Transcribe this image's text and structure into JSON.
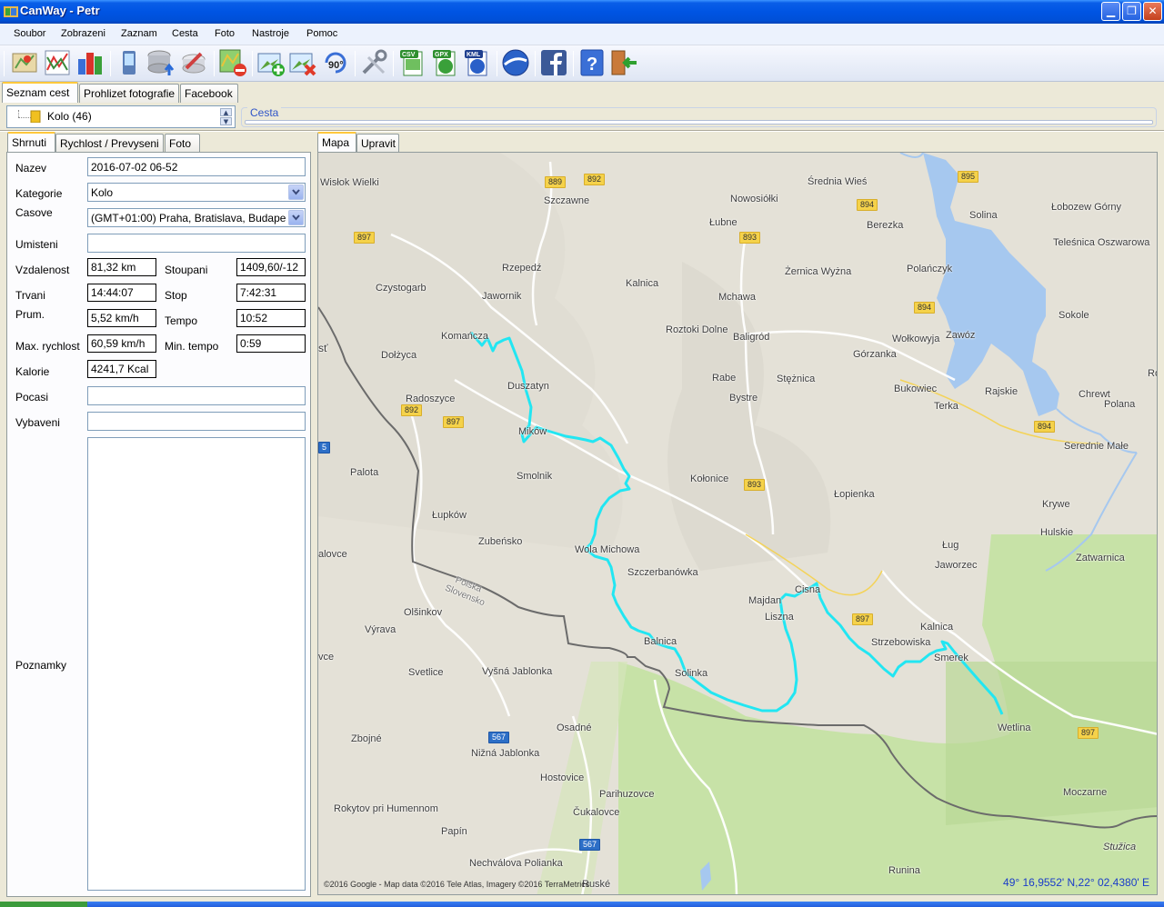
{
  "window": {
    "title": "CanWay - Petr",
    "minimize_icon": "minimize-icon",
    "maximize_icon": "maximize-icon",
    "close_icon": "close-icon"
  },
  "menu": [
    "Soubor",
    "Zobrazeni",
    "Zaznam",
    "Cesta",
    "Foto",
    "Nastroje",
    "Pomoc"
  ],
  "toolbar_icons": [
    "map-pin-icon",
    "chart-lines-icon",
    "bar-chart-icon",
    "gps-device-icon",
    "database-upload-icon",
    "database-delete-icon",
    "map-delete-icon",
    "add-photo-icon",
    "delete-photo-icon",
    "rotate-90-icon",
    "tools-icon",
    "csv-export-icon",
    "gpx-export-icon",
    "kml-export-icon",
    "google-earth-icon",
    "facebook-icon",
    "help-icon",
    "exit-icon"
  ],
  "toolbar_labels": {
    "rotate": "90°",
    "csv": "CSV",
    "gpx": "GPX",
    "kml": "KML"
  },
  "main_tabs": [
    "Seznam cest",
    "Prohlizet fotografie",
    "Facebook"
  ],
  "tree": {
    "label": "Kolo (46)"
  },
  "cesta_label": "Cesta",
  "left_tabs": [
    "Shrnuti",
    "Rychlost / Prevyseni",
    "Foto"
  ],
  "map_tabs": [
    "Mapa",
    "Upravit"
  ],
  "summary": {
    "nazev_label": "Nazev",
    "nazev_value": "2016-07-02 06-52",
    "kategorie_label": "Kategorie",
    "kategorie_value": "Kolo",
    "casove_label": "Casove",
    "casove_value": "(GMT+01:00) Praha, Bratislava, Budape",
    "umisteni_label": "Umisteni",
    "umisteni_value": "",
    "vzdalenost_label": "Vzdalenost",
    "vzdalenost_value": "81,32 km",
    "stoupani_label": "Stoupani",
    "stoupani_value": "1409,60/-12",
    "trvani_label": "Trvani",
    "trvani_value": "14:44:07",
    "stop_label": "Stop",
    "stop_value": "7:42:31",
    "prum_label": "Prum.",
    "prum_value": "5,52 km/h",
    "tempo_label": "Tempo",
    "tempo_value": "10:52",
    "max_label": "Max. rychlost",
    "max_value": "60,59 km/h",
    "min_tempo_label": "Min. tempo",
    "min_tempo_value": "0:59",
    "kalorie_label": "Kalorie",
    "kalorie_value": "4241,7 Kcal",
    "pocasi_label": "Pocasi",
    "pocasi_value": "",
    "vybaveni_label": "Vybaveni",
    "vybaveni_value": "",
    "poznamky_label": "Poznamky",
    "poznamky_value": ""
  },
  "map": {
    "places": [
      "Wisłok Wielki",
      "Szczawne",
      "Nowosiółki",
      "Średnia Wieś",
      "Solina",
      "Łobozew Górny",
      "Łubne",
      "Berezka",
      "Teleśnica Oszwarowa",
      "Rzepedź",
      "Polańczyk",
      "Czystogarb",
      "Jawornik",
      "Kalnica",
      "Żernica Wyżna",
      "Mchawa",
      "Sokole",
      "Komańcza",
      "Roztoki Dolne",
      "Baligród",
      "Wołkowyja",
      "Zawóz",
      "Dołżyca",
      "Górzanka",
      "Duszatyn",
      "Rabe",
      "Stężnica",
      "Bukowiec",
      "Rajskie",
      "Chrewt",
      "Radoszyce",
      "Bystre",
      "Terka",
      "Polana",
      "Roso",
      "Mików",
      "Serednie Małe",
      "Palota",
      "Smolnik",
      "Kołonice",
      "Łopienka",
      "Krywe",
      "Łupków",
      "Hulskie",
      "Zubeńsko",
      "Ług",
      "alovce",
      "Wola Michowa",
      "Szczerbanówka",
      "Jaworzec",
      "Zatwarnica",
      "Polska",
      "Slovensko",
      "Cisna",
      "Olšinkov",
      "Majdan",
      "Liszna",
      "Výrava",
      "Kalnica",
      "Balnica",
      "Strzebowiska",
      "Smerek",
      "vce",
      "Svetlice",
      "Solinka",
      "Vyšná Jablonka",
      "Wetlina",
      "Osadné",
      "Zbojné",
      "Nižná Jablonka",
      "Hostovice",
      "Moczarne",
      "Parihuzovce",
      "Rokytov pri Humennom",
      "Čukalovce",
      "Stužica",
      "Papín",
      "Nechválova Polianka",
      "Runina",
      "Ruské",
      "sť"
    ],
    "road_numbers": [
      "889",
      "892",
      "895",
      "894",
      "897",
      "893",
      "894",
      "892",
      "897",
      "894",
      "893",
      "897",
      "567",
      "897",
      "567",
      "5"
    ],
    "copyright": "©2016 Google - Map data ©2016 Tele Atlas, Imagery ©2016 TerraMetrics",
    "coords": "49° 16,9552' N,22° 02,4380' E",
    "track_color": "#22e6f2"
  }
}
